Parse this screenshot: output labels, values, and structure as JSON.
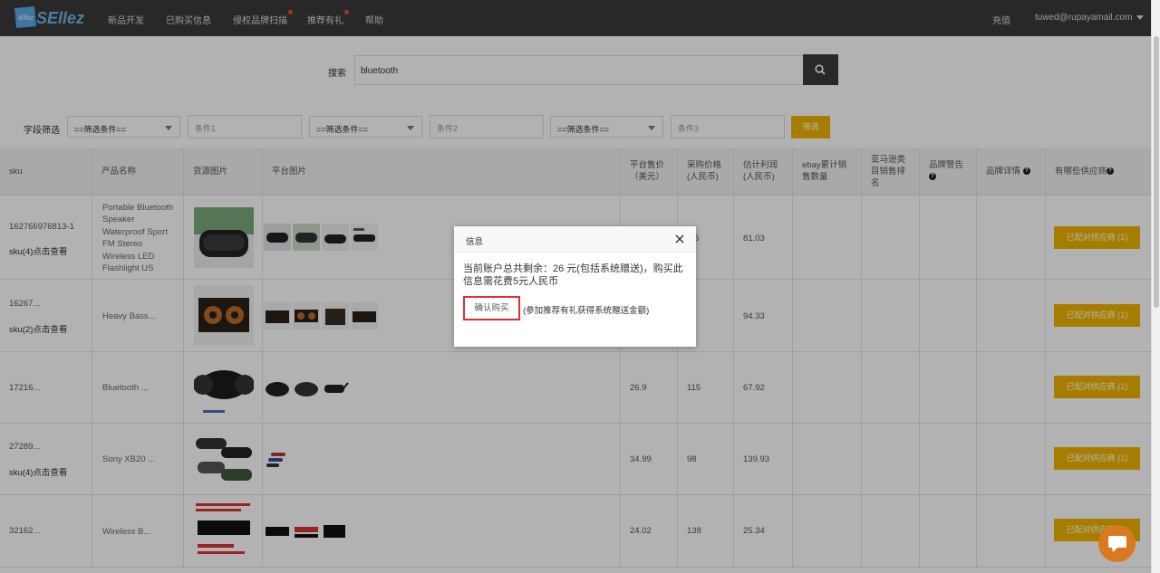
{
  "nav": {
    "logo_text": "SEllez",
    "items": [
      {
        "label": "新品开发",
        "dot": false
      },
      {
        "label": "已购买信息",
        "dot": false
      },
      {
        "label": "侵权品牌扫描",
        "dot": true
      },
      {
        "label": "推荐有礼",
        "dot": true
      },
      {
        "label": "帮助",
        "dot": false
      }
    ],
    "recharge": "充值",
    "account": "tuwed@rupayamail.com"
  },
  "search": {
    "label": "搜索",
    "value": "bluetooth"
  },
  "filter": {
    "label": "字段筛选",
    "selects": [
      "==筛选条件==",
      "==筛选条件==",
      "==筛选条件=="
    ],
    "conditions": [
      "条件1",
      "条件2",
      "条件3"
    ],
    "button": "筛选"
  },
  "table": {
    "headers": {
      "sku": "sku",
      "name": "产品名称",
      "source_img": "货源图片",
      "platform_img": "平台图片",
      "price_l1": "平台售价",
      "price_l2": "（美元）",
      "purchase_l1": "采购价格",
      "purchase_l2": "(人民币)",
      "profit_l1": "估计利润",
      "profit_l2": "(人民币)",
      "ebay_l1": "ebay累计销",
      "ebay_l2": "售数量",
      "amazon_l1": "亚马逊类",
      "amazon_l2": "目销售排",
      "amazon_l3": "名",
      "brand_warn": "品牌警告",
      "brand_detail": "品牌详情",
      "suppliers": "有哪些供应商"
    },
    "rows": [
      {
        "sku": "162766976813-1",
        "sku_link": "sku(4)点击查看",
        "name": "Portable Bluetooth Speaker Waterproof Sport FM Stereo Wireless LED Flashlight US",
        "price": "",
        "purchase": "...6",
        "profit": "81.03",
        "supplier_btn": "已配对供应商 (1)"
      },
      {
        "sku": "16267...",
        "sku_link": "sku(2)点击查看",
        "name": "Heavy Bass...",
        "price": "",
        "purchase": "",
        "profit": "94.33",
        "supplier_btn": "已配对供应商 (1)"
      },
      {
        "sku": "17216...",
        "sku_link": "",
        "name": "Bluetooth ...",
        "price": "26.9",
        "purchase": "115",
        "profit": "67.92",
        "supplier_btn": "已配对供应商 (1)"
      },
      {
        "sku": "27289...",
        "sku_link": "sku(4)点击查看",
        "name": "Sony XB20 ...",
        "price": "34.99",
        "purchase": "98",
        "profit": "139.93",
        "supplier_btn": "已配对供应商 (1)"
      },
      {
        "sku": "32162...",
        "sku_link": "",
        "name": "Wireless B...",
        "price": "24.02",
        "purchase": "138",
        "profit": "25.34",
        "supplier_btn": "已配对供应商 (1)"
      }
    ]
  },
  "modal": {
    "title": "信息",
    "message": "当前账户总共剩余：26 元(包括系统赠送)，购买此信息需花费5元人民币",
    "confirm": "确认购买",
    "note": "(参加推荐有礼获得系统赠送金额)"
  },
  "colors": {
    "accent": "#f0b400",
    "nav_bg": "#3a3a3a",
    "confirm_border": "#e03030"
  }
}
